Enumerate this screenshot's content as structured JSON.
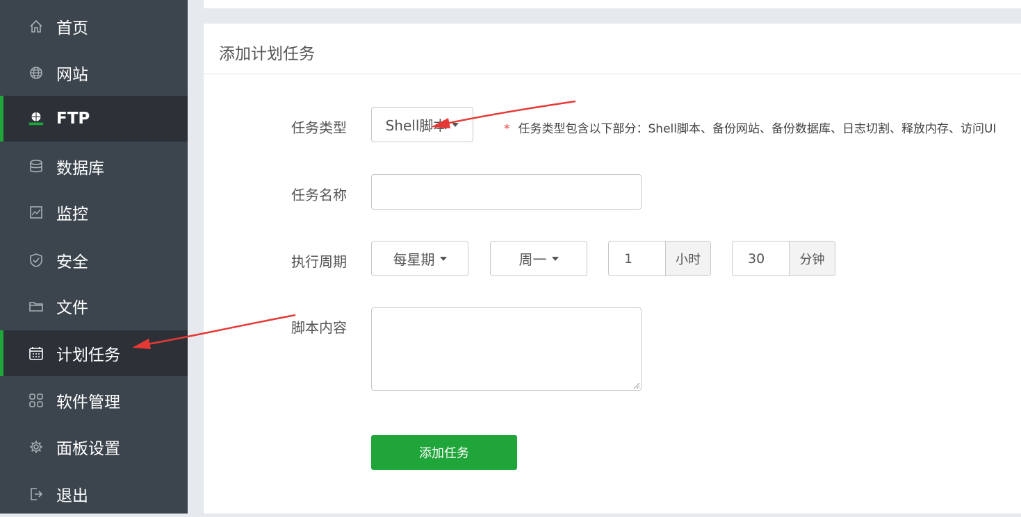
{
  "sidebar": {
    "items": [
      {
        "label": "首页",
        "icon": "home-icon"
      },
      {
        "label": "网站",
        "icon": "globe-icon"
      },
      {
        "label": "FTP",
        "icon": "ftp-icon"
      },
      {
        "label": "数据库",
        "icon": "database-icon"
      },
      {
        "label": "监控",
        "icon": "monitor-icon"
      },
      {
        "label": "安全",
        "icon": "shield-icon"
      },
      {
        "label": "文件",
        "icon": "folder-icon"
      },
      {
        "label": "计划任务",
        "icon": "calendar-icon"
      },
      {
        "label": "软件管理",
        "icon": "apps-icon"
      },
      {
        "label": "面板设置",
        "icon": "gear-icon"
      },
      {
        "label": "退出",
        "icon": "logout-icon"
      }
    ],
    "active_index": 7,
    "accent": "#20a53a"
  },
  "panel": {
    "title": "添加计划任务"
  },
  "form": {
    "task_type_label": "任务类型",
    "task_type_value": "Shell脚本",
    "hint_star": "*",
    "hint_text": "任务类型包含以下部分：Shell脚本、备份网站、备份数据库、日志切割、释放内存、访问UI",
    "task_name_label": "任务名称",
    "task_name_value": "",
    "cycle_label": "执行周期",
    "cycle_type": "每星期",
    "weekday": "周一",
    "hour_value": "1",
    "hour_unit": "小时",
    "minute_value": "30",
    "minute_unit": "分钟",
    "script_label": "脚本内容",
    "script_value": "",
    "submit_label": "添加任务"
  },
  "colors": {
    "sidebar_bg": "#3c444d",
    "sidebar_active_bg": "#2c3138",
    "button_green": "#20a53a",
    "annotation_arrow": "#e53935"
  }
}
